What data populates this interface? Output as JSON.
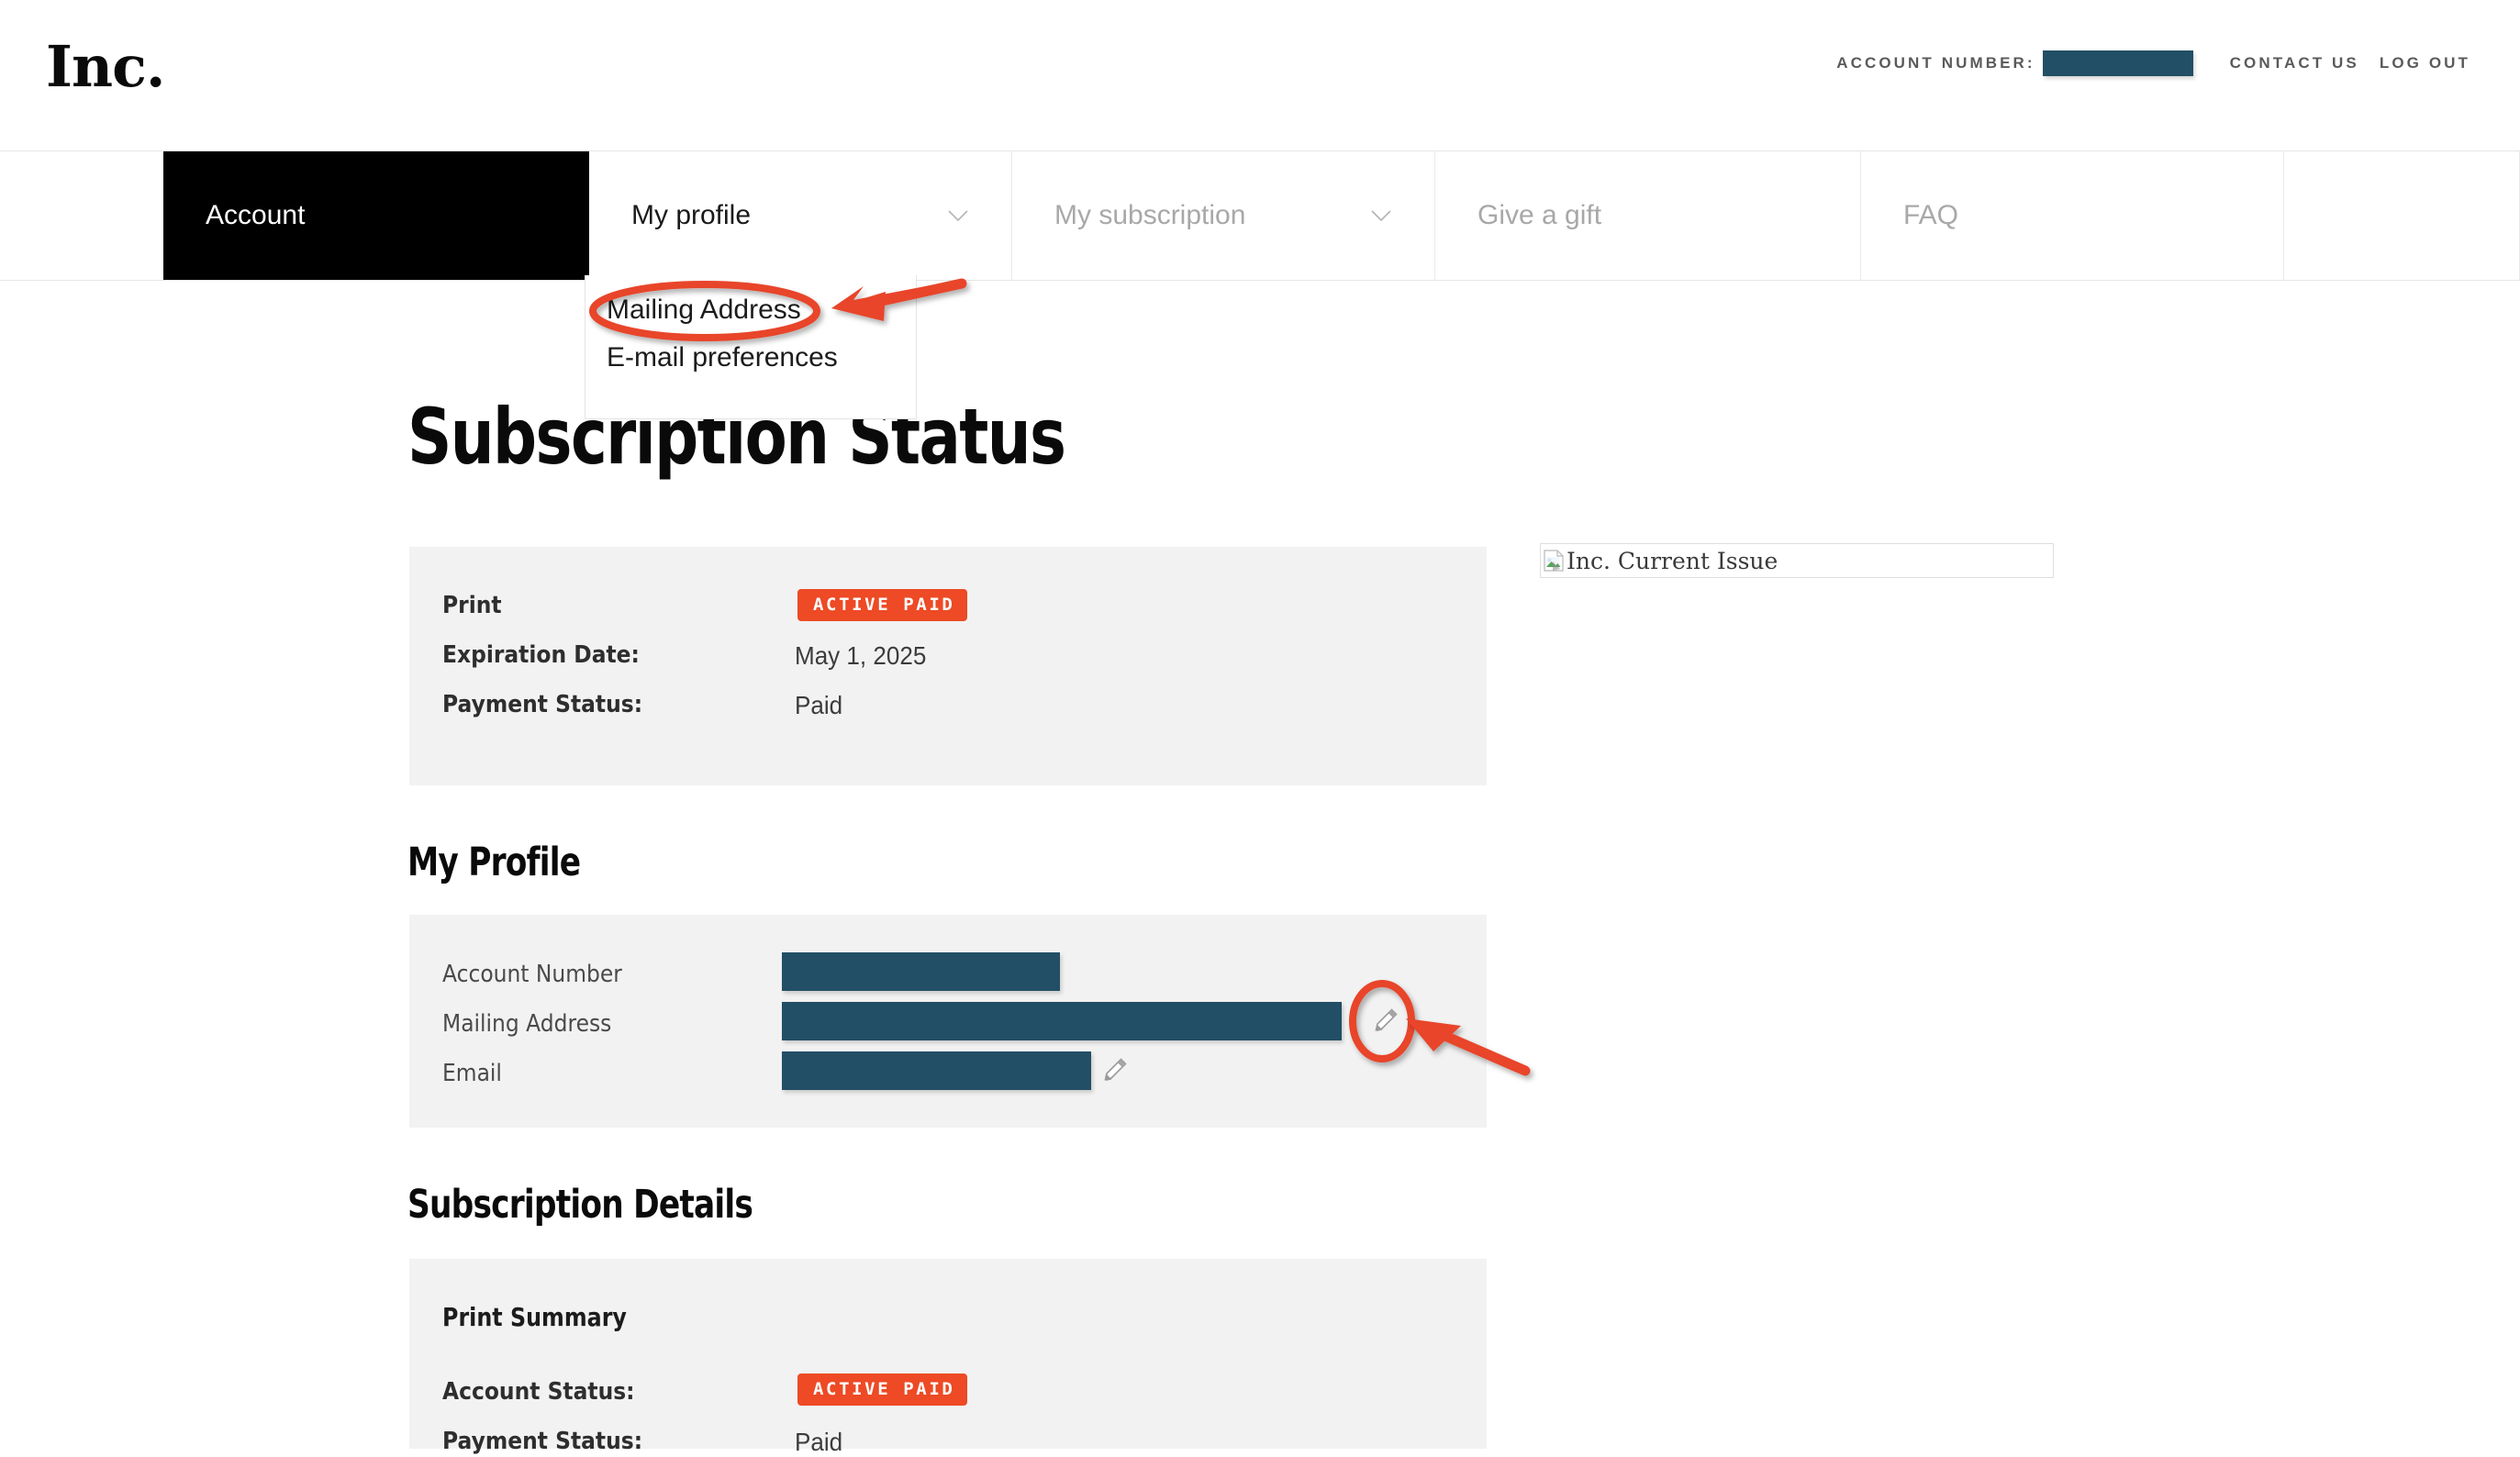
{
  "header": {
    "logo_text": "Inc.",
    "account_number_label": "ACCOUNT NUMBER:",
    "account_number_value": "",
    "contact_us_label": "CONTACT US",
    "log_out_label": "LOG OUT"
  },
  "nav": {
    "items": [
      {
        "label": "Account",
        "state": "section",
        "has_chevron": false
      },
      {
        "label": "My profile",
        "state": "current",
        "has_chevron": true
      },
      {
        "label": "My subscription",
        "state": "default",
        "has_chevron": true
      },
      {
        "label": "Give a gift",
        "state": "default",
        "has_chevron": false
      },
      {
        "label": "FAQ",
        "state": "default",
        "has_chevron": false
      }
    ],
    "chevron_icon": "chevron-down-icon"
  },
  "dropdown": {
    "open_for": "My profile",
    "items": [
      {
        "label": "Mailing Address",
        "highlighted": true
      },
      {
        "label": "E-mail preferences",
        "highlighted": false
      }
    ]
  },
  "main": {
    "page_title": "Subscription Status",
    "print_card": {
      "title": "Print",
      "status_badge": "ACTIVE PAID",
      "rows": [
        {
          "label": "Expiration Date:",
          "value": "May 1, 2025"
        },
        {
          "label": "Payment Status:",
          "value": "Paid"
        }
      ]
    },
    "profile_section": {
      "heading": "My Profile",
      "rows": [
        {
          "label": "Account Number",
          "value": "",
          "redacted": true,
          "editable": false
        },
        {
          "label": "Mailing Address",
          "value": "",
          "redacted": true,
          "editable": true
        },
        {
          "label": "Email",
          "value": "",
          "redacted": true,
          "editable": true
        }
      ],
      "edit_icon": "pencil-icon"
    },
    "details_section": {
      "heading": "Subscription Details",
      "sub_heading": "Print Summary",
      "rows": [
        {
          "label": "Account Status:",
          "value": "ACTIVE PAID",
          "is_badge": true
        },
        {
          "label": "Payment Status:",
          "value": "Paid",
          "is_badge": false
        }
      ]
    },
    "cover_image": {
      "alt_text": "Inc. Current Issue",
      "icon": "broken-image-icon"
    }
  },
  "annotations": {
    "accent_color": "#E8452A",
    "markers": [
      {
        "type": "ellipse",
        "target": "Mailing Address menu item"
      },
      {
        "type": "arrow",
        "target": "Mailing Address menu item"
      },
      {
        "type": "ellipse",
        "target": "Mailing Address edit pencil"
      },
      {
        "type": "arrow",
        "target": "Mailing Address edit pencil"
      }
    ]
  },
  "colors": {
    "badge_bg": "#ED4A25",
    "redaction": "#224F66",
    "card_bg": "#F2F2F2",
    "nav_active_bg": "#000000"
  }
}
